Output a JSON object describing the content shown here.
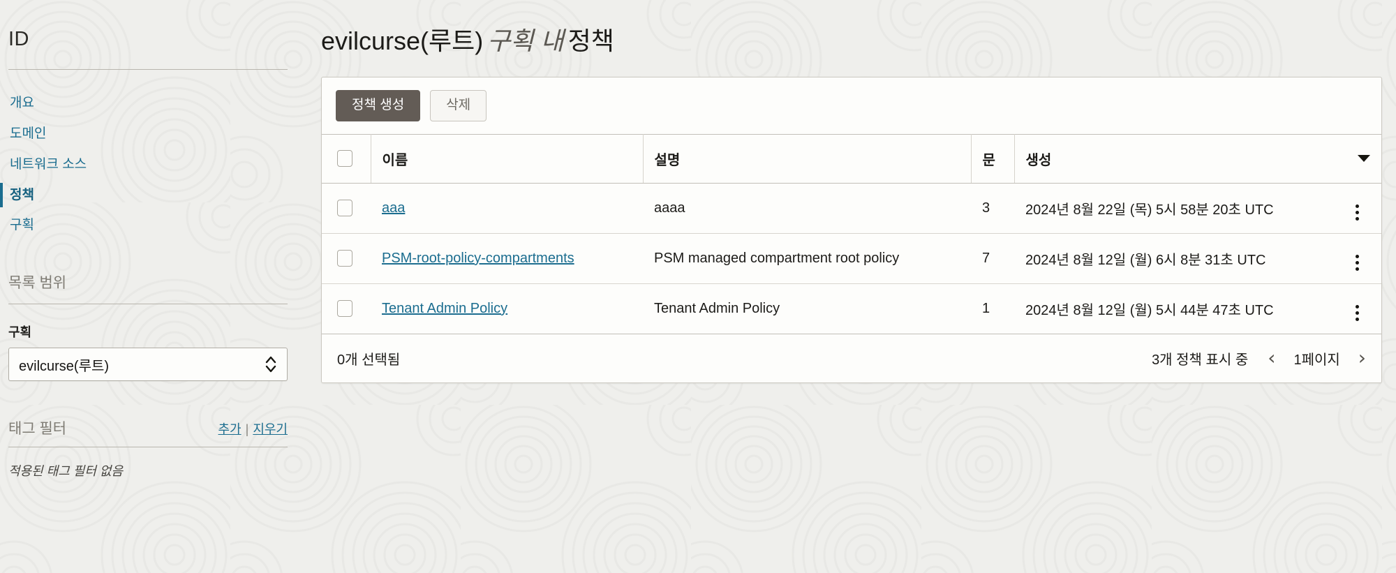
{
  "sidebar": {
    "title": "ID",
    "nav_items": [
      {
        "label": "개요",
        "active": false
      },
      {
        "label": "도메인",
        "active": false
      },
      {
        "label": "네트워크 소스",
        "active": false
      },
      {
        "label": "정책",
        "active": true
      },
      {
        "label": "구획",
        "active": false
      }
    ],
    "list_scope": {
      "section_label": "목록 범위",
      "field_label": "구획",
      "selected_value": "evilcurse(루트)"
    },
    "tag_filter": {
      "label": "태그 필터",
      "add_label": "추가",
      "separator": "|",
      "clear_label": "지우기",
      "empty_text": "적용된 태그 필터 없음"
    }
  },
  "main": {
    "title_prefix": "evilcurse(루트)",
    "title_middle": "구획 내",
    "title_suffix": "정책",
    "toolbar": {
      "create_label": "정책 생성",
      "delete_label": "삭제"
    },
    "table": {
      "columns": {
        "name": "이름",
        "description": "설명",
        "statements": "문",
        "created": "생성"
      },
      "sort_icon": "caret-down-icon",
      "rows": [
        {
          "name": "aaa",
          "description": "aaaa",
          "statements": "3",
          "created": "2024년 8월 22일 (목) 5시 58분 20초 UTC"
        },
        {
          "name": "PSM-root-policy-compartments",
          "description": "PSM managed compartment root policy",
          "statements": "7",
          "created": "2024년 8월 12일 (월) 6시 8분 31초 UTC"
        },
        {
          "name": "Tenant Admin Policy",
          "description": "Tenant Admin Policy",
          "statements": "1",
          "created": "2024년 8월 12일 (월) 5시 44분 47초 UTC"
        }
      ]
    },
    "footer": {
      "selected_text": "0개 선택됨",
      "showing_text": "3개 정책 표시 중",
      "prev_icon": "chevron-left-icon",
      "page_label": "1페이지",
      "next_icon": "chevron-right-icon"
    }
  },
  "colors": {
    "link": "#1b6d8f",
    "primary_button": "#635c56",
    "background": "#efefec",
    "card": "#fdfdfb",
    "active_indicator": "#1b6d8f"
  }
}
